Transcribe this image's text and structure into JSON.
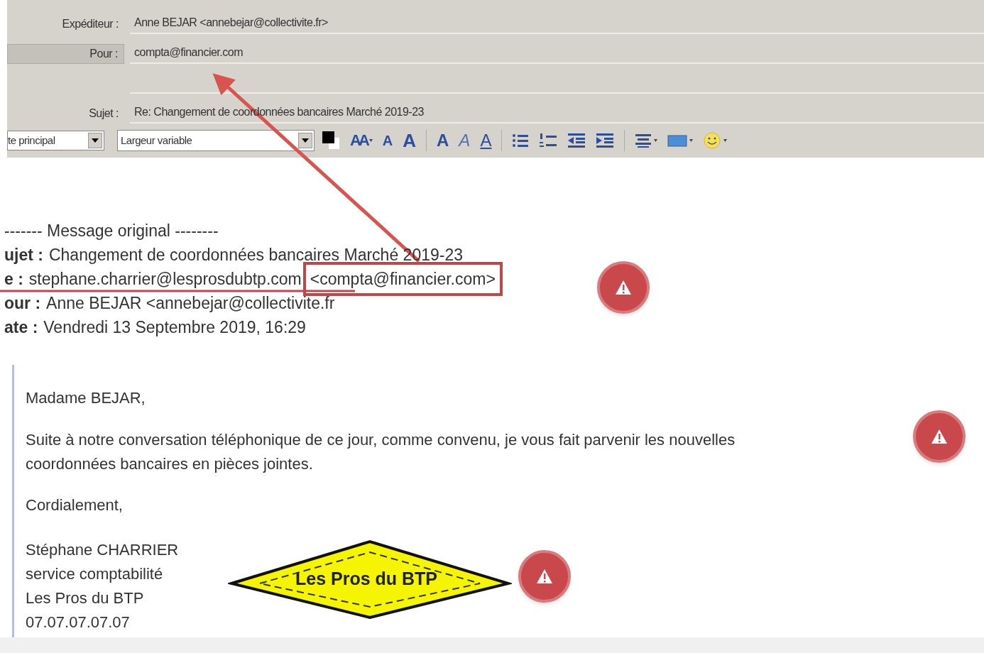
{
  "header": {
    "fields": [
      {
        "label": "Expéditeur :",
        "value": "Anne BEJAR <annebejar@collectivite.fr>",
        "selected": false
      },
      {
        "label": "Pour :",
        "value": "compta@financier.com",
        "selected": true
      },
      {
        "selected": false
      },
      {
        "label": "Sujet :",
        "value": "Re: Changement de coordonnées bancaires Marché 2019-23",
        "selected": false
      }
    ]
  },
  "toolbar": {
    "style_select": "te principal",
    "font_select": "Largeur variable",
    "items": [
      {
        "kind": "color"
      },
      {
        "kind": "text",
        "text": "AA",
        "caret": true
      },
      {
        "kind": "text",
        "text": "A",
        "caret": false
      },
      {
        "kind": "text",
        "text": "A",
        "caret": false
      },
      {
        "kind": "separator"
      },
      {
        "kind": "text",
        "text": "A",
        "caret": false
      },
      {
        "kind": "text",
        "text": "A",
        "caret": false
      },
      {
        "kind": "text",
        "text": "A",
        "caret": false
      },
      {
        "kind": "separator"
      },
      {
        "kind": "bullets"
      },
      {
        "kind": "numbers"
      },
      {
        "kind": "outdent"
      },
      {
        "kind": "indent"
      },
      {
        "kind": "separator"
      },
      {
        "kind": "align",
        "caret": true
      },
      {
        "kind": "image",
        "caret": true
      },
      {
        "kind": "smiley",
        "caret": true
      }
    ]
  },
  "original_message": {
    "heading": "------- Message original --------",
    "lines": [
      {
        "label": "ujet :",
        "value": "Changement de coordonnées bancaires Marché 2019-23"
      },
      {
        "label": "e :",
        "value": "stephane.charrier@lesprosdubtp.com",
        "highlight": "<compta@financier.com>"
      },
      {
        "label": "our :",
        "value": "Anne BEJAR <annebejar@collectivite.fr"
      },
      {
        "label": "ate :",
        "value": "Vendredi 13 Septembre 2019, 16:29"
      }
    ]
  },
  "body": {
    "greeting": "Madame BEJAR,",
    "paragraph": "Suite à notre conversation téléphonique de ce jour, comme convenu, je vous fait parvenir les nouvelles coordonnées bancaires en pièces jointes.",
    "closing": "Cordialement,",
    "signature": [
      "Stéphane CHARRIER",
      "service comptabilité",
      "Les Pros du BTP",
      "07.07.07.07.07"
    ],
    "logo_text": "Les Pros du BTP"
  }
}
